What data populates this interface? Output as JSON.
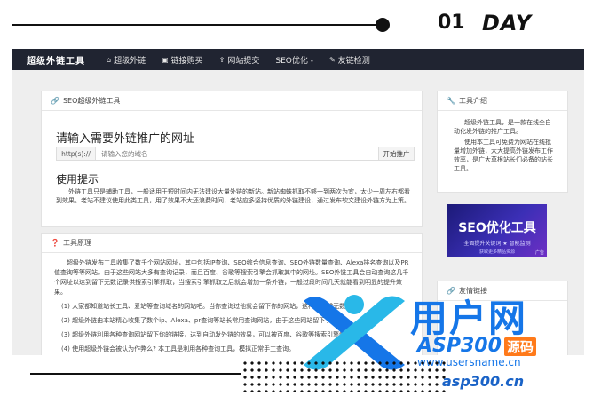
{
  "decor": {
    "day_number": "01",
    "day_word": "DAY"
  },
  "nav": {
    "brand": "超级外链工具",
    "items": [
      {
        "icon": "home-icon",
        "glyph": "⌂",
        "label": "超级外链"
      },
      {
        "icon": "link-icon",
        "glyph": "▣",
        "label": "链接购买"
      },
      {
        "icon": "upload-icon",
        "glyph": "⇪",
        "label": "网站提交"
      },
      {
        "icon": "",
        "glyph": "",
        "label": "SEO优化 -"
      },
      {
        "icon": "check-icon",
        "glyph": "✎",
        "label": "友链检测"
      }
    ]
  },
  "main": {
    "panel_title": "SEO超级外链工具",
    "heading": "请输入需要外链推广的网址",
    "url_prefix": "http(s)://",
    "url_placeholder": "请输入您的域名",
    "submit_label": "开始推广",
    "tips_heading": "使用提示",
    "tips_text": "外链工具只是辅助工具，一般适用于短时间内无法建设大量外链的新站。新站蜘蛛抓取不够一到两次为宜，太少一周左右都看到效果。老站不建议使用此类工具，用了效果不大还浪费时间，老站应多坚持优质的外链建设，通过发布软文建设外链方为上策。"
  },
  "principle": {
    "panel_title": "工具原理",
    "intro": "超级外链发布工具收集了数千个网站网址，其中包括IP查询、SEO综合信息查询、SEO外链数量查询、Alexa排名查询以及PR值查询等等网站。由于这些网站大多有查询记录，而且百度、谷歌等搜索引擎会抓取其中的网址。SEO外链工具会自动查询这几千个网址以达到留下无数记录供搜索引擎抓取，当搜索引擎抓取之后就会增加一条外链，一般过段时间几天就能看到明显的提升效果。",
    "items": [
      "(1) 大家都知道站长工具、爱站等查询域名的网站吧。当你查询过他就会留下你的网站，这样会形成无数外链。",
      "(2) 超级外链由本站精心收集了数个ip、Alexa、pr查询等站长常用查询网站，由于这些网站留下了外链。",
      "(3) 超级外链利用各种查询网站留下你的链接，达到自动发外链的效果，可以被百度、谷歌等搜索引擎快速收录。",
      "(4) 使用超级外链会被认为作弊么? 本工具是利用各种查询工具，模拟正常手工查询。"
    ]
  },
  "sidebar": {
    "intro_title": "工具介绍",
    "intro_p1": "超级外链工具，是一款在线全自动化发外链的推广工具。",
    "intro_p2": "使用本工具可免费为网站在线批量增加外链，大大提高外链发布工作效率，是广大草根站长们必备的站长工具。",
    "banner_title": "SEO优化工具",
    "banner_sub": "全面提升关键词 ★ 智能监测",
    "banner_sub2": "获取更多精品资源",
    "banner_tag": "广告",
    "links_title": "友情链接"
  },
  "watermark": {
    "brand": "用户网",
    "asp_text": "ASP300",
    "asp_tag": "源码",
    "url": "www.usersname.cn",
    "bottom": "asp300.cn"
  },
  "colors": {
    "navbar": "#202431",
    "accent_blue": "#1576e8",
    "accent_cyan": "#29b8e8",
    "accent_orange": "#ff7a1a"
  }
}
